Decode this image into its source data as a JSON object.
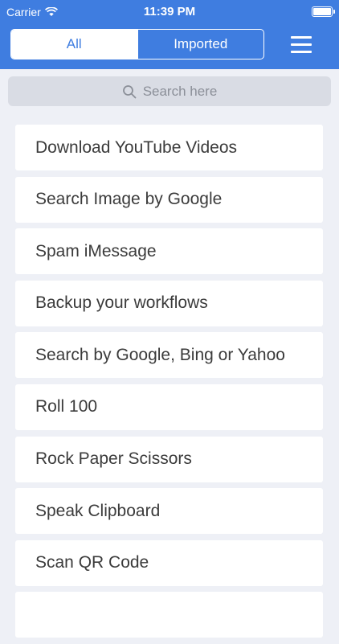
{
  "status_bar": {
    "carrier": "Carrier",
    "time": "11:39 PM",
    "battery_level": 1.0
  },
  "header": {
    "tabs": [
      {
        "label": "All",
        "active": true
      },
      {
        "label": "Imported",
        "active": false
      }
    ],
    "menu_icon": "hamburger-icon"
  },
  "search": {
    "placeholder": "Search here",
    "icon": "search-icon"
  },
  "workflows": [
    {
      "label": "Download YouTube Videos"
    },
    {
      "label": "Search Image by Google"
    },
    {
      "label": "Spam iMessage"
    },
    {
      "label": "Backup your workflows"
    },
    {
      "label": "Search by Google, Bing or Yahoo"
    },
    {
      "label": "Roll 100"
    },
    {
      "label": "Rock Paper Scissors"
    },
    {
      "label": "Speak Clipboard"
    },
    {
      "label": "Scan QR Code"
    },
    {
      "label": ""
    }
  ],
  "colors": {
    "header": "#3f7de0",
    "background": "#eef0f6"
  }
}
